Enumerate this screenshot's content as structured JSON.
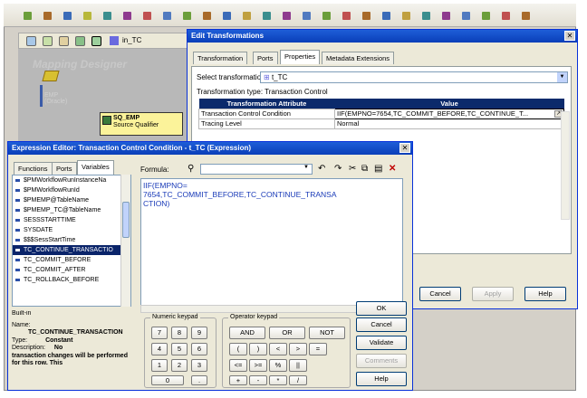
{
  "workspace": {
    "background_label": "Mapping Designer",
    "source_label": "EMP (Oracle)",
    "sq_name": "SQ_EMP",
    "sq_subtitle": "Source Qualifier",
    "toolbar_tab": "in_TC"
  },
  "edit_transformations": {
    "title": "Edit Transformations",
    "tabs": [
      "Transformation",
      "Ports",
      "Properties",
      "Metadata Extensions"
    ],
    "active_tab": "Properties",
    "select_label": "Select transformation:",
    "selected_transformation": "t_TC",
    "type_label": "Transformation type:",
    "type_value": "Transaction Control",
    "grid_headers": [
      "Transformation Attribute",
      "Value"
    ],
    "rows": [
      {
        "attribute": "Transaction Control Condition",
        "value": "IIF(EMPNO=7654,TC_COMMIT_BEFORE,TC_CONTINUE_T..."
      },
      {
        "attribute": "Tracing Level",
        "value": "Normal"
      }
    ],
    "buttons": {
      "cancel": "Cancel",
      "apply": "Apply",
      "help": "Help"
    }
  },
  "expression_editor": {
    "title": "Expression Editor: Transaction Control Condition - t_TC (Expression)",
    "tabs": [
      "Functions",
      "Ports",
      "Variables"
    ],
    "active_tab": "Variables",
    "variables": [
      "$PMWorkflowRunInstanceNa",
      "$PMWorkflowRunId",
      "$PMEMP@TableName",
      "$PMEMP_TC@TableName",
      "SESSSTARTTIME",
      "SYSDATE",
      "$$$SessStartTime",
      "TC_CONTINUE_TRANSACTIO",
      "TC_COMMIT_BEFORE",
      "TC_COMMIT_AFTER",
      "TC_ROLLBACK_BEFORE"
    ],
    "selected_variable": "TC_CONTINUE_TRANSACTIO",
    "info": {
      "category": "Built-in",
      "name_label": "Name:",
      "name_value": "TC_CONTINUE_TRANSACTION",
      "type_label": "Type:",
      "type_value": "Constant",
      "description_label": "Description:",
      "description_value": "No",
      "description_text": "transaction changes will be performed for this row. This"
    },
    "formula_label": "Formula:",
    "formula_text": "IIF(EMPNO=7654,TC_COMMIT_BEFORE,TC_CONTINUE_TRANSACTION)",
    "formula_display_lines": [
      "IIF(EMPNO=",
      "7654,TC_COMMIT_BEFORE,TC_CONTINUE_TRANSA",
      "CTION)"
    ],
    "numeric_keypad": {
      "label": "Numeric keypad",
      "keys": [
        "7",
        "8",
        "9",
        "4",
        "5",
        "6",
        "1",
        "2",
        "3",
        "0",
        "."
      ]
    },
    "operator_keypad": {
      "label": "Operator keypad",
      "keys": [
        "AND",
        "OR",
        "NOT",
        "(",
        ")",
        "<",
        ">",
        "=",
        "<=",
        ">=",
        "%",
        "||",
        "+",
        "-",
        "*",
        "/"
      ]
    },
    "buttons": {
      "ok": "OK",
      "cancel": "Cancel",
      "validate": "Validate",
      "comments": "Comments",
      "help": "Help"
    }
  }
}
